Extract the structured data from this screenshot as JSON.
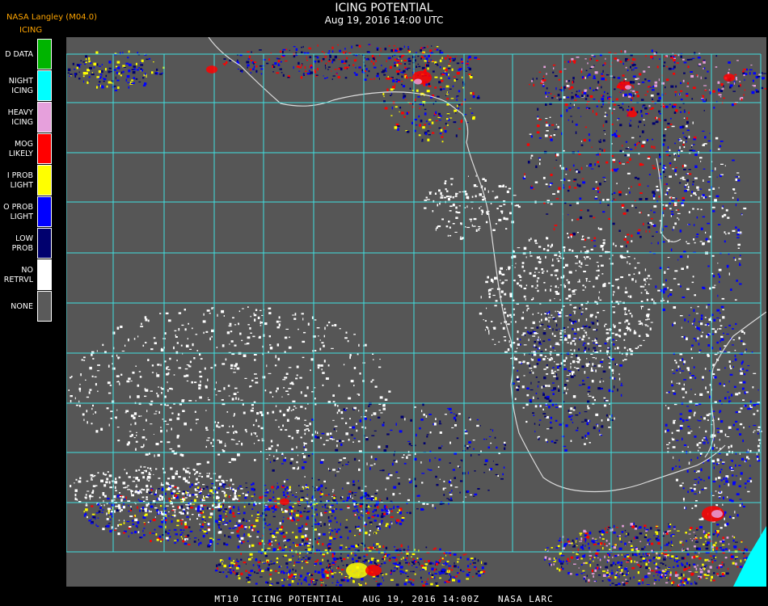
{
  "header": {
    "producer": "NASA Langley (M04.0)",
    "product": "ICING",
    "title": "ICING POTENTIAL",
    "subtitle": "Aug 19, 2016 14:00 UTC"
  },
  "legend": [
    {
      "label1": "D DATA",
      "label2": "",
      "color": "#00b400"
    },
    {
      "label1": "NIGHT",
      "label2": "ICING",
      "color": "#00ffff"
    },
    {
      "label1": "HEAVY",
      "label2": "ICING",
      "color": "#e6a0dc"
    },
    {
      "label1": "MOG",
      "label2": "LIKELY",
      "color": "#ff0000"
    },
    {
      "label1": "I PROB",
      "label2": "LIGHT",
      "color": "#ffff00"
    },
    {
      "label1": "O PROB",
      "label2": "LIGHT",
      "color": "#0000ff"
    },
    {
      "label1": "LOW",
      "label2": "PROB",
      "color": "#00006e"
    },
    {
      "label1": "NO",
      "label2": "RETRVL",
      "color": "#ffffff"
    },
    {
      "label1": "NONE",
      "label2": "",
      "color": "#5a5a5a"
    }
  ],
  "footer": "MT10  ICING POTENTIAL   AUG 19, 2016 14:00Z   NASA LARC",
  "map": {
    "background": "#565656",
    "grid_color": "#40e0e0",
    "coast_color": "#dcdcdc"
  }
}
